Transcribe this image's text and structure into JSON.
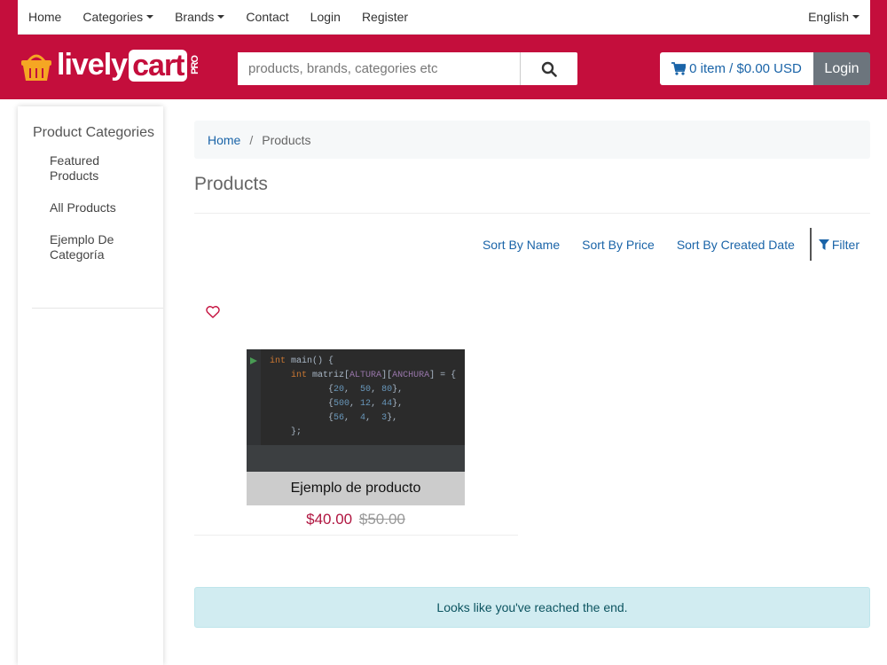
{
  "topnav": {
    "home": "Home",
    "categories": "Categories",
    "brands": "Brands",
    "contact": "Contact",
    "login": "Login",
    "register": "Register",
    "language": "English"
  },
  "header": {
    "logo_lively": "lively",
    "logo_cart": "cart",
    "logo_pro": "PRO",
    "search_placeholder": "products, brands, categories etc",
    "cart_summary": "0 item / $0.00 USD",
    "login_button": "Login"
  },
  "sidebar": {
    "title": "Product Categories",
    "items": [
      {
        "label": "Featured Products"
      },
      {
        "label": "All Products"
      },
      {
        "label": "Ejemplo De Categoría"
      }
    ]
  },
  "breadcrumb": {
    "home": "Home",
    "separator": "/",
    "current": "Products"
  },
  "page": {
    "title": "Products",
    "sort_name": "Sort By Name",
    "sort_price": "Sort By Price",
    "sort_date": "Sort By Created Date",
    "filter": "Filter"
  },
  "products": [
    {
      "name": "Ejemplo de producto",
      "price": "$40.00",
      "old_price": "$50.00"
    }
  ],
  "end_message": "Looks like you've reached the end.",
  "colors": {
    "brand": "#c40e3c",
    "link": "#1a64a8",
    "price": "#b01540"
  }
}
